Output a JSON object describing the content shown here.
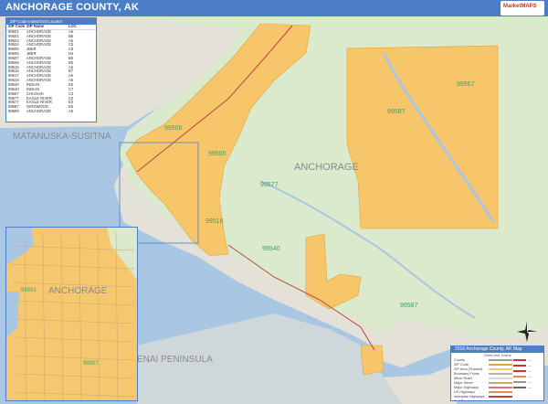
{
  "header": {
    "title": "ANCHORAGE COUNTY, AK",
    "logo_text": "MarketMAPS"
  },
  "colors": {
    "header_blue": "#4b7ec7",
    "water": "#a9c7e3",
    "county_green": "#dbe9cd",
    "zip_orange": "#f7c66a",
    "outside_gray": "#e4e1d8"
  },
  "map_labels": {
    "region_mat_su": "MATANUSKA-SUSITNA",
    "region_anchorage": "ANCHORAGE",
    "region_kenai": "ENAI PENINSULA",
    "inset_anchorage": "ANCHORAGE"
  },
  "zip_labels": [
    {
      "zip": "99506"
    },
    {
      "zip": "99505"
    },
    {
      "zip": "99567"
    },
    {
      "zip": "99577"
    },
    {
      "zip": "99587"
    },
    {
      "zip": "99516"
    },
    {
      "zip": "99540"
    },
    {
      "zip": "99587"
    },
    {
      "zip": "99501"
    },
    {
      "zip": "99507"
    }
  ],
  "zip_table": {
    "title": "ZIP Code Index/Grid Locator",
    "headers": [
      "ZIP Code",
      "ZIP Name",
      "LOC"
    ],
    "rows": [
      [
        "99501",
        "ANCHORAGE",
        "A5"
      ],
      [
        "99502",
        "ANCHORAGE",
        "B5"
      ],
      [
        "99503",
        "ANCHORAGE",
        "A5"
      ],
      [
        "99504",
        "ANCHORAGE",
        "C5"
      ],
      [
        "99505",
        "JBER",
        "C5"
      ],
      [
        "99506",
        "JBER",
        "D4"
      ],
      [
        "99507",
        "ANCHORAGE",
        "B5"
      ],
      [
        "99508",
        "ANCHORAGE",
        "B5"
      ],
      [
        "99515",
        "ANCHORAGE",
        "A5"
      ],
      [
        "99516",
        "ANCHORAGE",
        "B7"
      ],
      [
        "99517",
        "ANCHORAGE",
        "A5"
      ],
      [
        "99518",
        "ANCHORAGE",
        "A5"
      ],
      [
        "99540",
        "INDIAN",
        "E5"
      ],
      [
        "99540",
        "INDIAN",
        "C7"
      ],
      [
        "99567",
        "CHUGIAK",
        "C3"
      ],
      [
        "99577",
        "EAGLE RIVER",
        "C5"
      ],
      [
        "99577",
        "EAGLE RIVER",
        "E3"
      ],
      [
        "99587",
        "GIRDWOOD",
        "E5"
      ],
      [
        "99599",
        "ANCHORAGE",
        "A5"
      ]
    ]
  },
  "legend": {
    "title": "2016 Anchorage County, AK Map",
    "subtitle": "Cities and Towns",
    "rows": [
      {
        "label": "County",
        "color": "#9a9a9a"
      },
      {
        "label": "ZIP Code",
        "color": "#e3a437"
      },
      {
        "label": "ZIP Area (Shaded)",
        "color": "#f7c66a"
      },
      {
        "label": "Boundary Points",
        "color": "#b5b5b5"
      },
      {
        "label": "Minor Road",
        "color": "#d9d9d9"
      },
      {
        "label": "Major Street",
        "color": "#c9a66b"
      },
      {
        "label": "Major Highways",
        "color": "#d47a7a"
      },
      {
        "label": "US Highways",
        "color": "#e58d4f"
      },
      {
        "label": "Interstate Highways",
        "color": "#c24141"
      },
      {
        "label": "Rail Road",
        "color": "#555555"
      }
    ],
    "right_items": [
      {
        "label": "—",
        "color": "#cc3333"
      },
      {
        "label": "—",
        "color": "#cc3333"
      },
      {
        "label": "—",
        "color": "#cc3333"
      },
      {
        "label": "—",
        "color": "#e58d4f"
      },
      {
        "label": "—",
        "color": "#999999"
      },
      {
        "label": "—",
        "color": "#666666"
      }
    ]
  }
}
